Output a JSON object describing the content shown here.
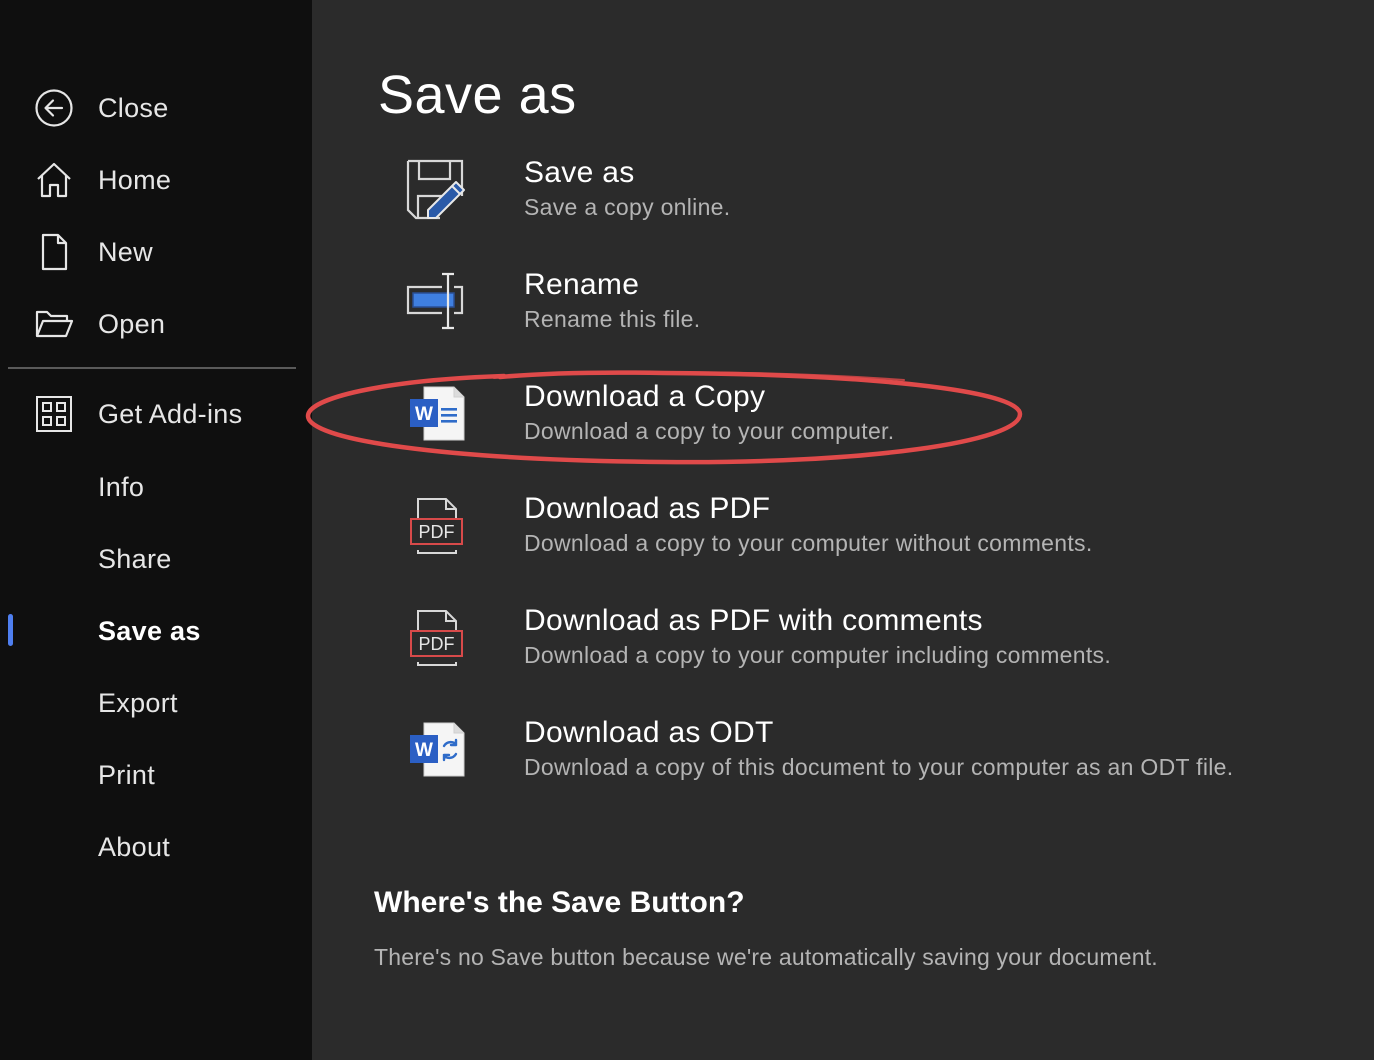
{
  "sidebar": {
    "items": [
      {
        "label": "Close",
        "icon": "back-arrow-icon"
      },
      {
        "label": "Home",
        "icon": "home-icon"
      },
      {
        "label": "New",
        "icon": "new-document-icon"
      },
      {
        "label": "Open",
        "icon": "folder-open-icon"
      },
      {
        "label": "Get Add-ins",
        "icon": "add-ins-grid-icon"
      },
      {
        "label": "Info"
      },
      {
        "label": "Share"
      },
      {
        "label": "Save as",
        "active": true
      },
      {
        "label": "Export"
      },
      {
        "label": "Print"
      },
      {
        "label": "About"
      }
    ],
    "accent_color": "#4f7ff0"
  },
  "main": {
    "title": "Save as",
    "options": [
      {
        "title": "Save as",
        "description": "Save a copy online.",
        "icon": "save-as-edit-icon"
      },
      {
        "title": "Rename",
        "description": "Rename this file.",
        "icon": "rename-icon"
      },
      {
        "title": "Download a Copy",
        "description": "Download a copy to your computer.",
        "icon": "word-document-icon",
        "highlighted": true
      },
      {
        "title": "Download as PDF",
        "description": "Download a copy to your computer without comments.",
        "icon": "pdf-icon",
        "icon_text": "PDF"
      },
      {
        "title": "Download as PDF with comments",
        "description": "Download a copy to your computer including comments.",
        "icon": "pdf-comments-icon",
        "icon_text": "PDF"
      },
      {
        "title": "Download as ODT",
        "description": "Download a copy of this document to your computer as an ODT file.",
        "icon": "word-odt-icon"
      }
    ],
    "note": {
      "title": "Where's the Save Button?",
      "text": "There's no Save button because we're automatically saving your document."
    },
    "highlight_color": "#e04a4a"
  }
}
